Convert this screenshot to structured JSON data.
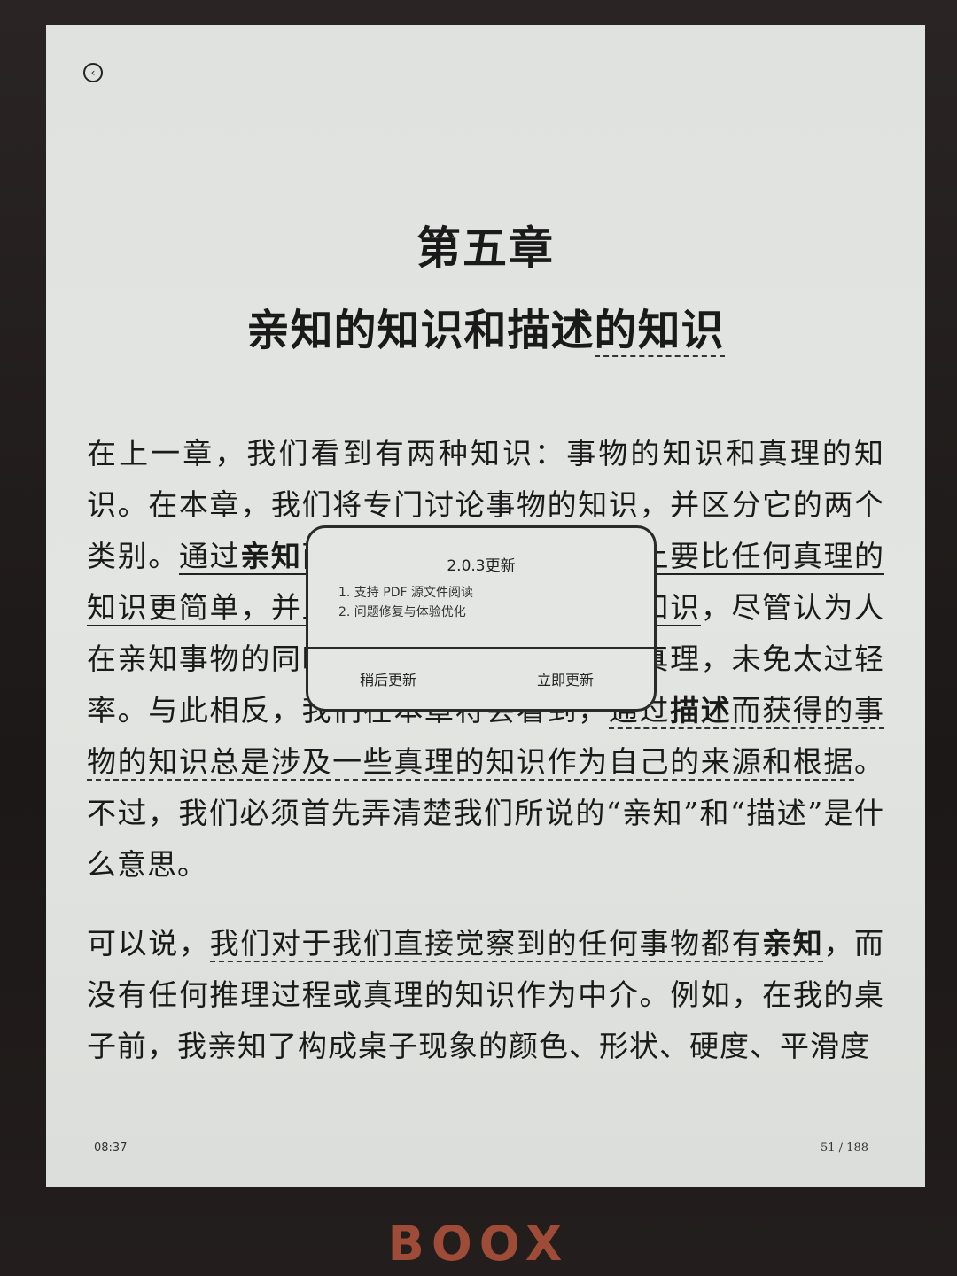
{
  "header": {
    "back_icon": "back-icon"
  },
  "chapter": {
    "number": "第五章",
    "title_a": "亲知的知识和描述",
    "title_b": "的知识"
  },
  "paragraph1": {
    "s1": "在上一章，我们看到有两种知识：事物的知识和真理的知识。在本章，我们将专门讨论事物的知识，并区分它的两个类别。",
    "s2_a": "通过",
    "s2_b": "亲知",
    "s2_c": "而获得的事物的知识本质上要比任何真理的知识更简单，并且在逻辑上独立于真理的知识",
    "s3": "，尽管认为人在亲知事物的同时不知道有关它们的某种真理，未免太过轻率。与此相反，我们在本章将会看到，",
    "s4_a": "通过",
    "s4_b": "描述",
    "s4_c": "而获得的事物的知识总是涉及一些真理的知识作为自己的来源和根",
    "s4_d": "据",
    "s5": "。不过，我们必须首先弄清楚我们所说的“亲知”和“描述”是什么意思。"
  },
  "paragraph2": {
    "s1": "可以说，",
    "s2_a": "我们对于我们直接觉察到的任何事物都有",
    "s2_b": "亲知",
    "s3": "，而没有任何推理过程或真理的知识作为中介。例如，在我的桌子前，我亲知了构成桌子现象的颜色、形状、硬度、平滑度"
  },
  "status": {
    "time": "08:37",
    "page": "51 / 188"
  },
  "dialog": {
    "title": "2.0.3更新",
    "items": [
      "1. 支持 PDF 源文件阅读",
      "2. 问题修复与体验优化"
    ],
    "later_label": "稍后更新",
    "now_label": "立即更新"
  },
  "device": {
    "brand": "BOOX"
  }
}
